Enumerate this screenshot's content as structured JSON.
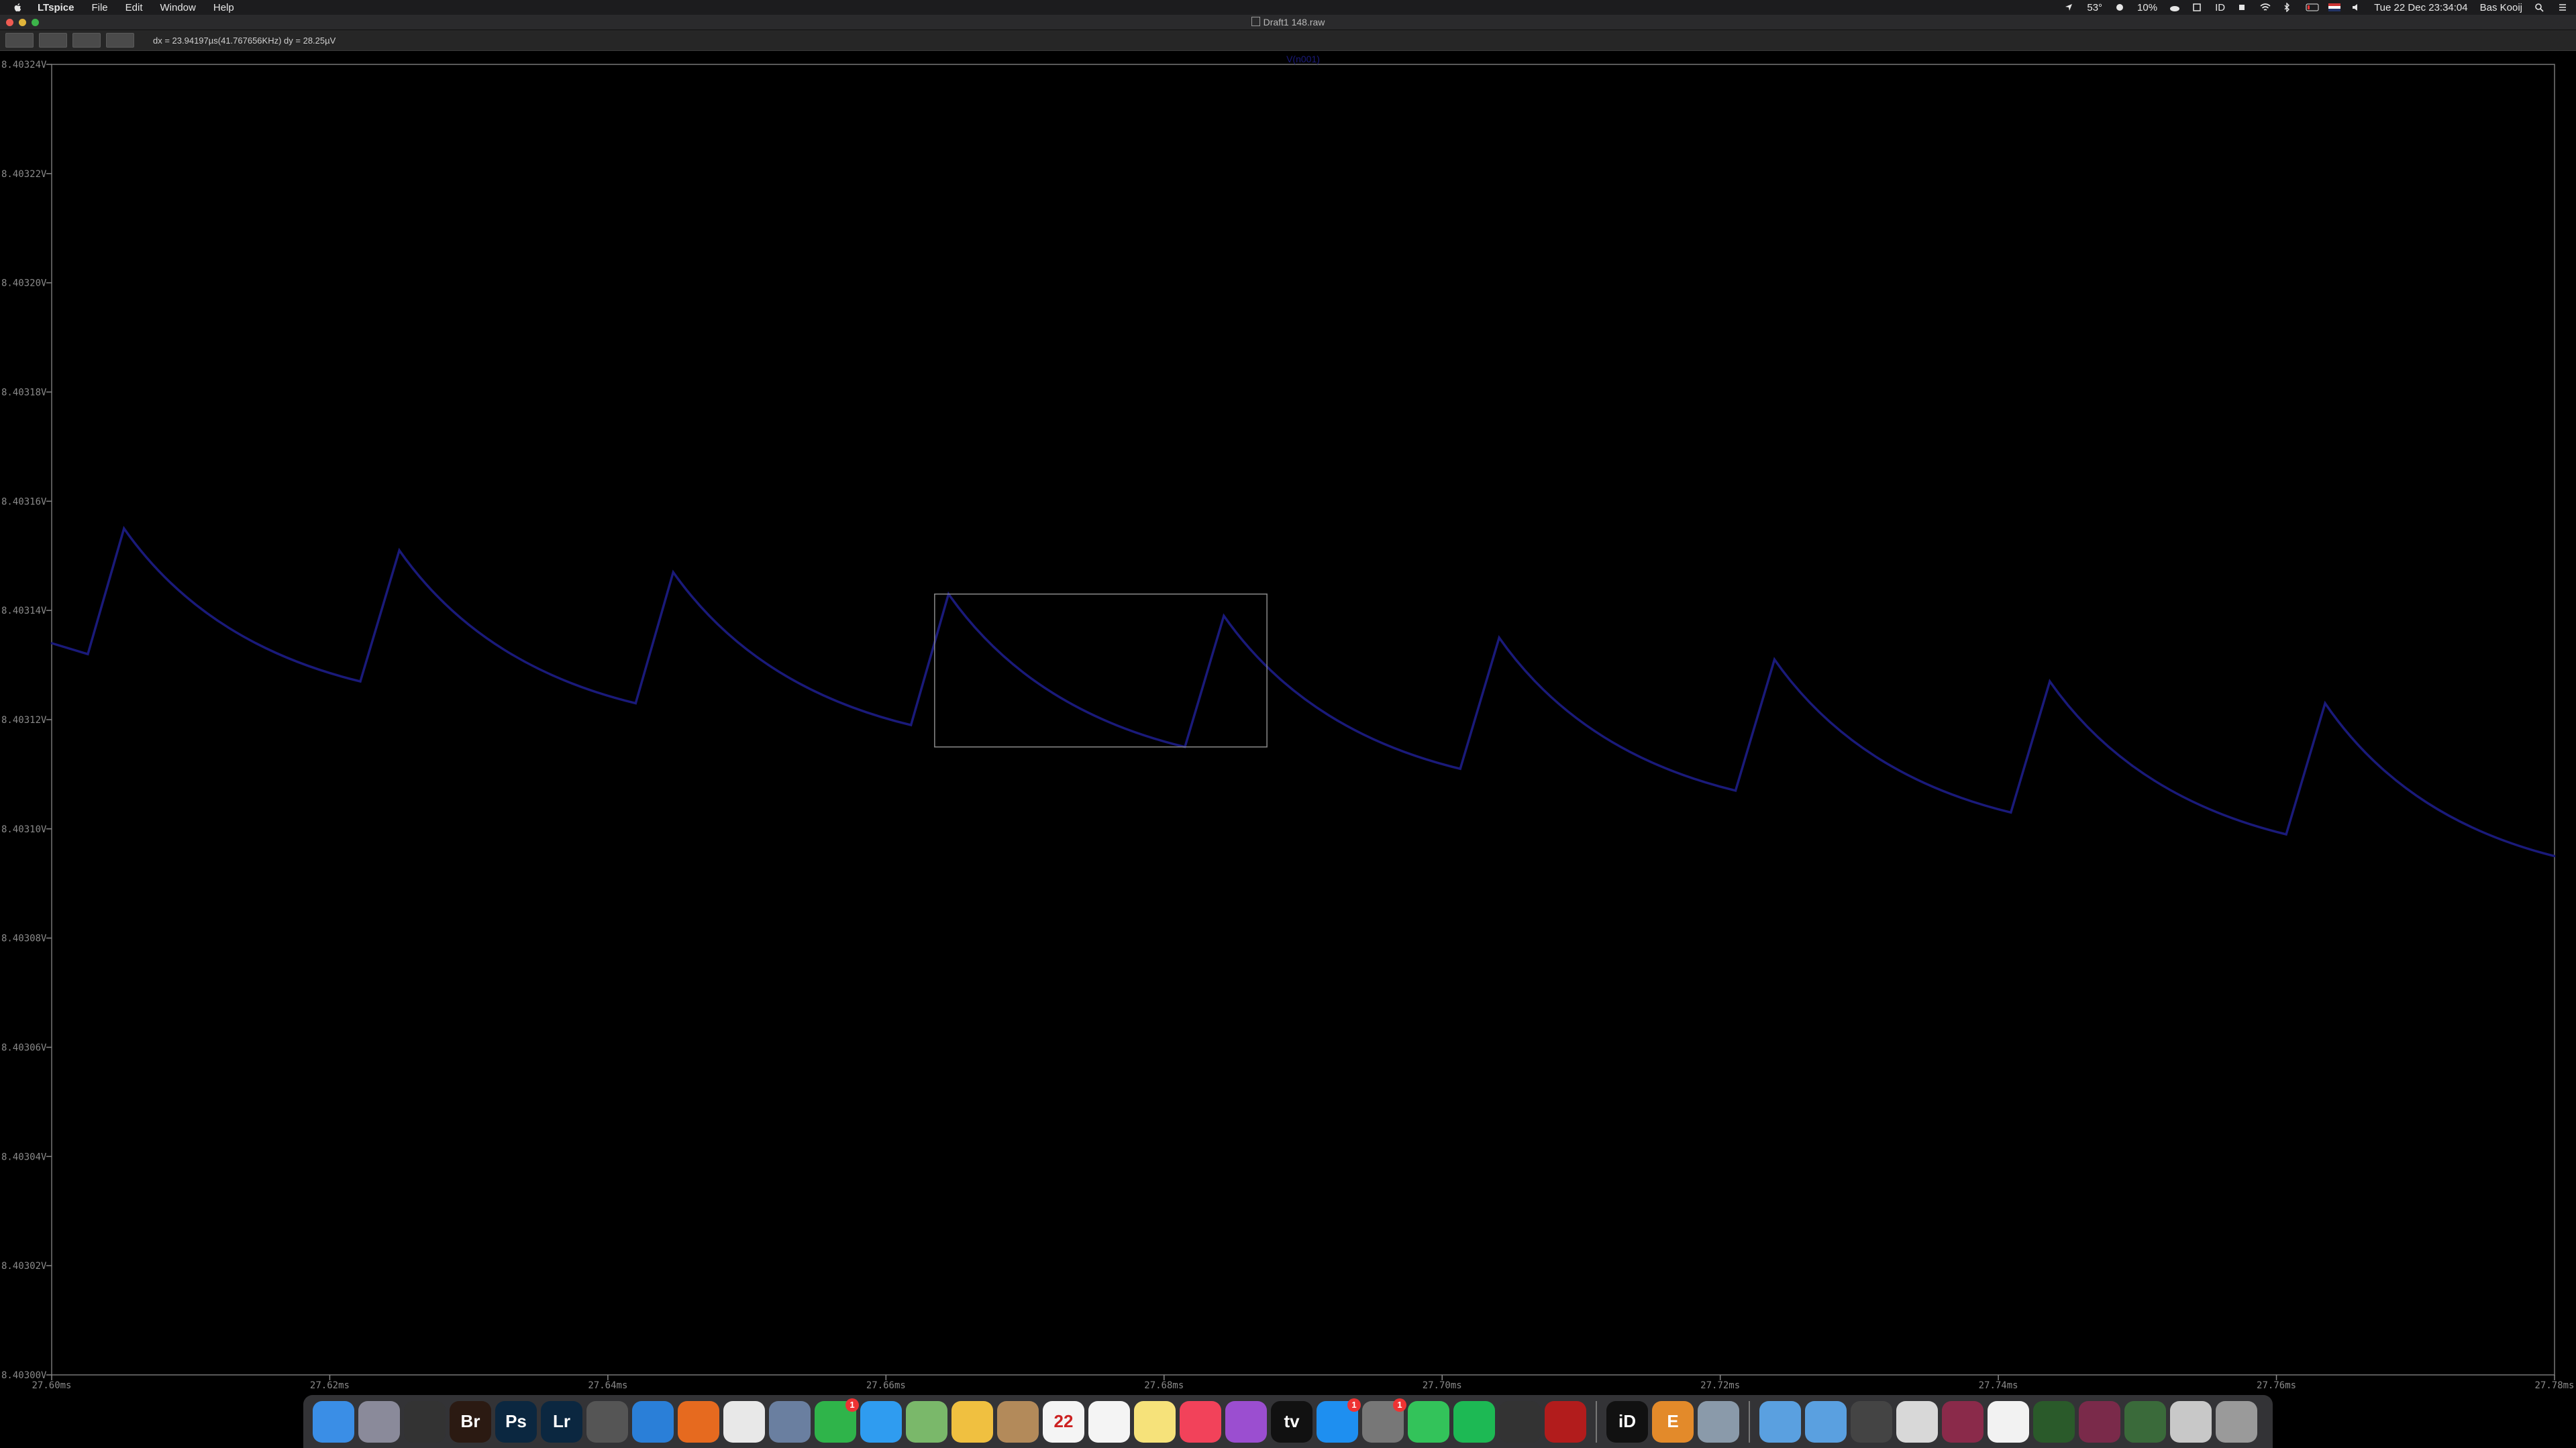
{
  "menubar": {
    "app_name": "LTspice",
    "menus": [
      "File",
      "Edit",
      "Window",
      "Help"
    ],
    "status": {
      "temperature": "53°",
      "battery": "10%",
      "input_source": "ID",
      "datetime": "Tue 22 Dec 23:34:04",
      "user": "Bas Kooij"
    }
  },
  "window": {
    "title": "Draft1 148.raw"
  },
  "toolbar": {
    "cursor_readout": "dx = 23.94197µs(41.767656KHz)    dy = 28.25µV"
  },
  "plot": {
    "trace_name": "V(n001)",
    "trace_color": "#1a1a7a",
    "background": "#000000",
    "zoom_box_color": "#8a8a8a"
  },
  "chart_data": {
    "type": "line",
    "title": "",
    "xlabel": "",
    "ylabel": "",
    "xlim": [
      27.6,
      27.78
    ],
    "ylim": [
      8.403,
      8.40324
    ],
    "x_unit": "ms",
    "y_unit": "V",
    "x_ticks": [
      "27.60ms",
      "27.62ms",
      "27.64ms",
      "27.66ms",
      "27.68ms",
      "27.70ms",
      "27.72ms",
      "27.74ms",
      "27.76ms",
      "27.78ms"
    ],
    "y_ticks": [
      "8.40324V",
      "8.40322V",
      "8.40320V",
      "8.40318V",
      "8.40316V",
      "8.40314V",
      "8.40312V",
      "8.40310V",
      "8.40308V",
      "8.40306V",
      "8.40304V",
      "8.40302V",
      "8.40300V"
    ],
    "series": [
      {
        "name": "V(n001)",
        "x": [
          27.6,
          27.6026,
          27.6052,
          27.6222,
          27.625,
          27.642,
          27.6447,
          27.6618,
          27.6645,
          27.6815,
          27.6843,
          27.7013,
          27.7041,
          27.7211,
          27.7239,
          27.7409,
          27.7437,
          27.7607,
          27.7635,
          27.78
        ],
        "y": [
          8.403134,
          8.403132,
          8.403155,
          8.403127,
          8.403151,
          8.403123,
          8.403147,
          8.403119,
          8.403143,
          8.403115,
          8.403139,
          8.403111,
          8.403135,
          8.403107,
          8.403131,
          8.403103,
          8.403127,
          8.403099,
          8.403123,
          8.403095
        ]
      }
    ],
    "zoom_box": {
      "x": [
        27.6635,
        27.6874
      ],
      "y": [
        8.403115,
        8.403143
      ]
    },
    "grid": false
  },
  "dock": {
    "items": [
      {
        "name": "finder",
        "label": "",
        "color": "#3a8ee6"
      },
      {
        "name": "launchpad",
        "label": "",
        "color": "#8a8a9a"
      },
      {
        "name": "final-cut",
        "label": "",
        "color": "#333"
      },
      {
        "name": "bridge",
        "label": "Br",
        "color": "#2b1a12"
      },
      {
        "name": "photoshop",
        "label": "Ps",
        "color": "#0b2740"
      },
      {
        "name": "lightroom",
        "label": "Lr",
        "color": "#0b2740"
      },
      {
        "name": "preview",
        "label": "",
        "color": "#555"
      },
      {
        "name": "safari",
        "label": "",
        "color": "#2a7fd8"
      },
      {
        "name": "firefox",
        "label": "",
        "color": "#e66a1f"
      },
      {
        "name": "chrome",
        "label": "",
        "color": "#e8e8e8"
      },
      {
        "name": "mail-draft",
        "label": "",
        "color": "#6a7fa0"
      },
      {
        "name": "facetime",
        "label": "",
        "color": "#2fb44a"
      },
      {
        "name": "messages",
        "label": "",
        "color": "#2f9cf0"
      },
      {
        "name": "maps",
        "label": "",
        "color": "#7ab86a"
      },
      {
        "name": "photos",
        "label": "",
        "color": "#f0c040"
      },
      {
        "name": "contacts",
        "label": "",
        "color": "#b38a5a"
      },
      {
        "name": "calendar",
        "label": "22",
        "color": "#f4f4f4"
      },
      {
        "name": "reminders",
        "label": "",
        "color": "#f4f4f4"
      },
      {
        "name": "notes",
        "label": "",
        "color": "#f6e27a"
      },
      {
        "name": "music",
        "label": "",
        "color": "#f2425a"
      },
      {
        "name": "podcasts",
        "label": "",
        "color": "#9b4ed0"
      },
      {
        "name": "tv",
        "label": "tv",
        "color": "#111"
      },
      {
        "name": "app-store",
        "label": "",
        "color": "#1e8ff0"
      },
      {
        "name": "system-preferences",
        "label": "",
        "color": "#777"
      },
      {
        "name": "whatsapp",
        "label": "",
        "color": "#33c35a"
      },
      {
        "name": "spotify",
        "label": "",
        "color": "#1db954"
      },
      {
        "name": "ltspice",
        "label": "",
        "color": "#333"
      },
      {
        "name": "ltspice-2",
        "label": "",
        "color": "#b21c1c"
      },
      {
        "name": "id",
        "label": "iD",
        "color": "#111"
      },
      {
        "name": "eagle",
        "label": "E",
        "color": "#e38a2a"
      },
      {
        "name": "preview-2",
        "label": "",
        "color": "#8a9aaa"
      },
      {
        "name": "folder-1",
        "label": "",
        "color": "#5aa0e0"
      },
      {
        "name": "folder-2",
        "label": "",
        "color": "#5aa0e0"
      },
      {
        "name": "window-1",
        "label": "",
        "color": "#444"
      },
      {
        "name": "window-2",
        "label": "",
        "color": "#d8d8d8"
      },
      {
        "name": "window-3",
        "label": "",
        "color": "#8a2a4a"
      },
      {
        "name": "window-4",
        "label": "",
        "color": "#f2f2f2"
      },
      {
        "name": "window-5",
        "label": "",
        "color": "#2a5a2a"
      },
      {
        "name": "window-6",
        "label": "",
        "color": "#7a2a4a"
      },
      {
        "name": "window-7",
        "label": "",
        "color": "#3a6a3a"
      },
      {
        "name": "window-8",
        "label": "",
        "color": "#c8c8c8"
      },
      {
        "name": "trash",
        "label": "",
        "color": "#9a9a9a"
      }
    ],
    "badges": {
      "facetime": "1",
      "app-store": "1",
      "system-preferences": "1"
    }
  }
}
